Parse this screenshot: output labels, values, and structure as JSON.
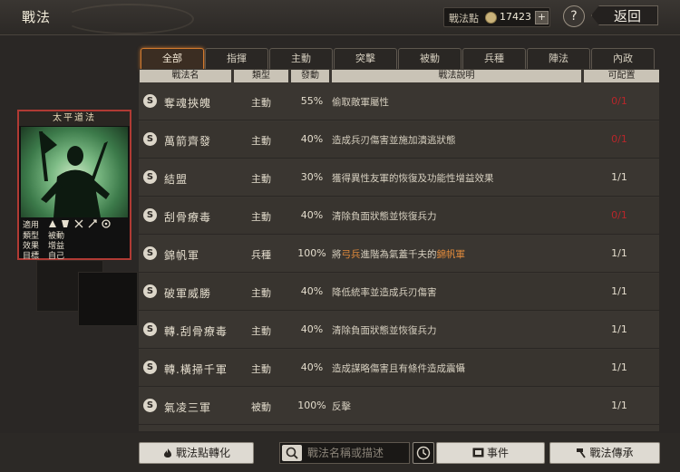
{
  "header": {
    "title": "戰法",
    "points_label": "戰法點",
    "points_value": "17423",
    "plus_label": "+",
    "help_label": "?",
    "back_label": "返回"
  },
  "tabs": [
    {
      "label": "全部",
      "active": true
    },
    {
      "label": "指揮",
      "active": false
    },
    {
      "label": "主動",
      "active": false
    },
    {
      "label": "突擊",
      "active": false
    },
    {
      "label": "被動",
      "active": false
    },
    {
      "label": "兵種",
      "active": false
    },
    {
      "label": "陣法",
      "active": false
    },
    {
      "label": "內政",
      "active": false
    }
  ],
  "columns": {
    "name": "戰法名",
    "type": "類型",
    "rate": "發動",
    "desc": "戰法說明",
    "cfg": "可配置"
  },
  "rows": [
    {
      "grade": "S",
      "name": "奪魂挾魄",
      "type": "主動",
      "rate": "55%",
      "desc": "偷取敵軍屬性",
      "cfg": "0/1",
      "cfg_ok": false
    },
    {
      "grade": "S",
      "name": "萬箭齊發",
      "type": "主動",
      "rate": "40%",
      "desc": "造成兵刃傷害並施加潰逃狀態",
      "cfg": "0/1",
      "cfg_ok": false
    },
    {
      "grade": "S",
      "name": "結盟",
      "type": "主動",
      "rate": "30%",
      "desc": "獲得異性友軍的恢復及功能性增益效果",
      "cfg": "1/1",
      "cfg_ok": true
    },
    {
      "grade": "S",
      "name": "刮骨療毒",
      "type": "主動",
      "rate": "40%",
      "desc": "清除負面狀態並恢復兵力",
      "cfg": "0/1",
      "cfg_ok": false
    },
    {
      "grade": "S",
      "name": "錦帆軍",
      "type": "兵種",
      "rate": "100%",
      "desc_pre": "將",
      "desc_hl1": "弓兵",
      "desc_mid": "進階為氣蓋千夫的",
      "desc_hl2": "錦帆軍",
      "cfg": "1/1",
      "cfg_ok": true
    },
    {
      "grade": "S",
      "name": "破軍威勝",
      "type": "主動",
      "rate": "40%",
      "desc": "降低統率並造成兵刃傷害",
      "cfg": "1/1",
      "cfg_ok": true
    },
    {
      "grade": "S",
      "name": "轉.刮骨療毒",
      "type": "主動",
      "rate": "40%",
      "desc": "清除負面狀態並恢復兵力",
      "cfg": "1/1",
      "cfg_ok": true
    },
    {
      "grade": "S",
      "name": "轉.橫掃千軍",
      "type": "主動",
      "rate": "40%",
      "desc": "造成謀略傷害且有條件造成震懾",
      "cfg": "1/1",
      "cfg_ok": true
    },
    {
      "grade": "S",
      "name": "氣凌三軍",
      "type": "被動",
      "rate": "100%",
      "desc": "反擊",
      "cfg": "1/1",
      "cfg_ok": true
    }
  ],
  "card": {
    "title": "太平道法",
    "labels": [
      "適用",
      "類型",
      "效果",
      "目標"
    ],
    "values": [
      "",
      "被動",
      "增益",
      "自己"
    ]
  },
  "bottom": {
    "convert_label": "戰法點轉化",
    "search_placeholder": "戰法名稱或描述",
    "events_label": "事件",
    "inherit_label": "戰法傳承"
  },
  "colors": {
    "accent": "#d27a2e",
    "unavailable": "#b8262a",
    "highlight": "#e08a3c"
  }
}
